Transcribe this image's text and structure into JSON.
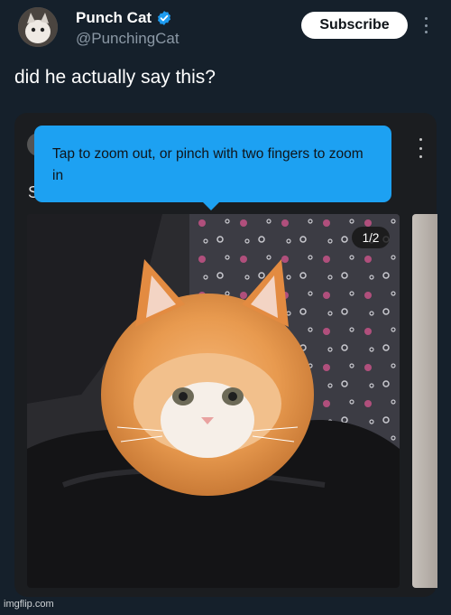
{
  "tweet": {
    "display_name": "Punch Cat",
    "handle": "@PunchingCat",
    "subscribe_label": "Subscribe",
    "text": "did he actually say this?",
    "verified_color": "#1d9bf0"
  },
  "embed": {
    "partial_text": "S",
    "tooltip_text": "Tap to zoom out, or pinch with two fingers to zoom in",
    "media_counter": "1/2",
    "tooltip_color": "#1da1f2"
  },
  "watermark": "imgflip.com",
  "icons": [
    "verified-badge-icon",
    "more-options-icon"
  ]
}
